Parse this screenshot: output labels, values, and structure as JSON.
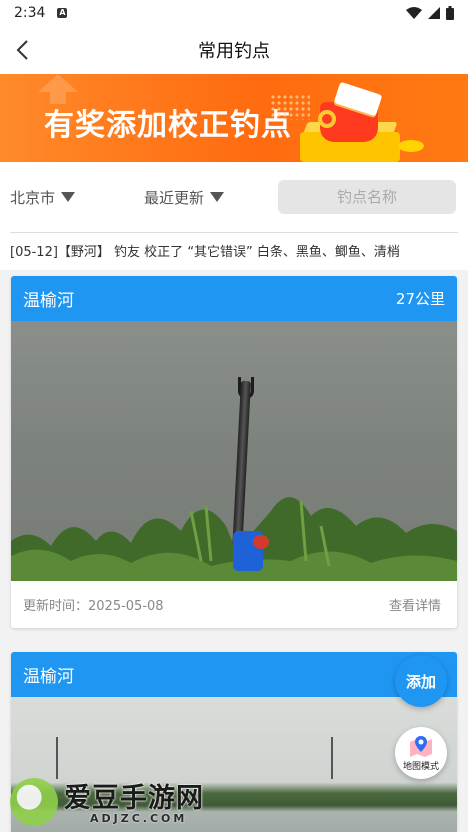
{
  "status_bar": {
    "time": "2:34",
    "notif_icon_text": "A",
    "icons": [
      "wifi-icon",
      "signal-icon",
      "battery-icon"
    ]
  },
  "nav": {
    "title": "常用钓点",
    "back_icon": "chevron-left-icon"
  },
  "banner": {
    "text": "有奖添加校正钓点"
  },
  "filters": {
    "city": "北京市",
    "sort": "最近更新",
    "search_placeholder": "钓点名称"
  },
  "news": {
    "text": "[05-12]【野河】 钓友 校正了 “其它错误” 白条、黑鱼、鲫鱼、清梢"
  },
  "spots": [
    {
      "name": "温榆河",
      "distance": "27公里",
      "updated": "更新时间：2025-05-08",
      "detail_link": "查看详情"
    },
    {
      "name": "温榆河",
      "distance": ""
    }
  ],
  "fab": {
    "add_label": "添加",
    "map_label": "地图模式"
  },
  "watermark": {
    "title": "爱豆手游网",
    "sub": "ADJZC.COM"
  },
  "colors": {
    "primary_blue": "#2096f3",
    "banner_orange": "#ff6b10"
  }
}
